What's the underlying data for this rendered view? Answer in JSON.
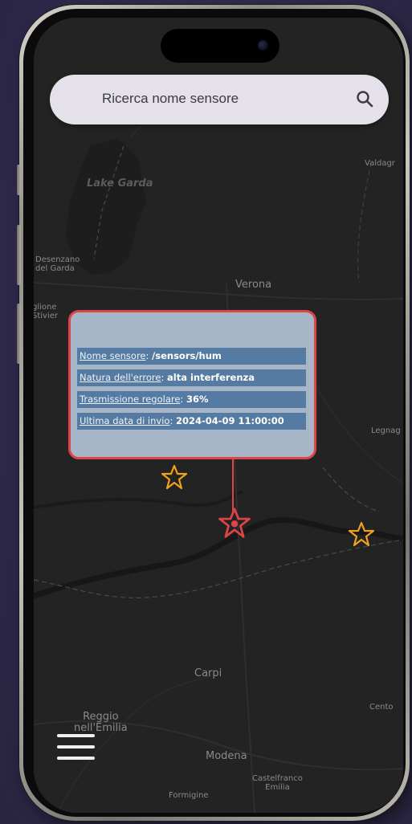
{
  "search": {
    "placeholder": "Ricerca nome sensore",
    "icon": "search-icon"
  },
  "map": {
    "labels": {
      "lake_garda": "Lake Garda",
      "valdagno": "Valdagr",
      "desenzano": "Desenzano\ndel Garda",
      "verona": "Verona",
      "castiglione": "glione\nStivier",
      "legnago": "Legnag",
      "carpi": "Carpi",
      "cento": "Cento",
      "reggio": "Reggio\nnell'Emilia",
      "modena": "Modena",
      "castelfranco": "Castelfranco\nEmilia",
      "formigine": "Formigine"
    },
    "background_color": "#232323"
  },
  "popup": {
    "border_color": "#de4346",
    "rows": [
      {
        "key": "Nome sensore",
        "sep": ": ",
        "value": "/sensors/hum"
      },
      {
        "key": "Natura dell'errore",
        "sep": ": ",
        "value": "alta interferenza"
      },
      {
        "key": "Trasmissione regolare",
        "sep": ": ",
        "value": "36%"
      },
      {
        "key": "Ultima data di invio",
        "sep": ": ",
        "value": "2024-04-09 11:00:00"
      }
    ]
  },
  "markers": [
    {
      "name": "sensor-star-marker",
      "color": "#f0a21a",
      "selected": false
    },
    {
      "name": "selected-sensor-star-marker",
      "color": "#de4346",
      "selected": true
    },
    {
      "name": "sensor-star-marker",
      "color": "#f0a21a",
      "selected": false
    }
  ],
  "menu": {
    "icon": "hamburger-menu-icon"
  }
}
